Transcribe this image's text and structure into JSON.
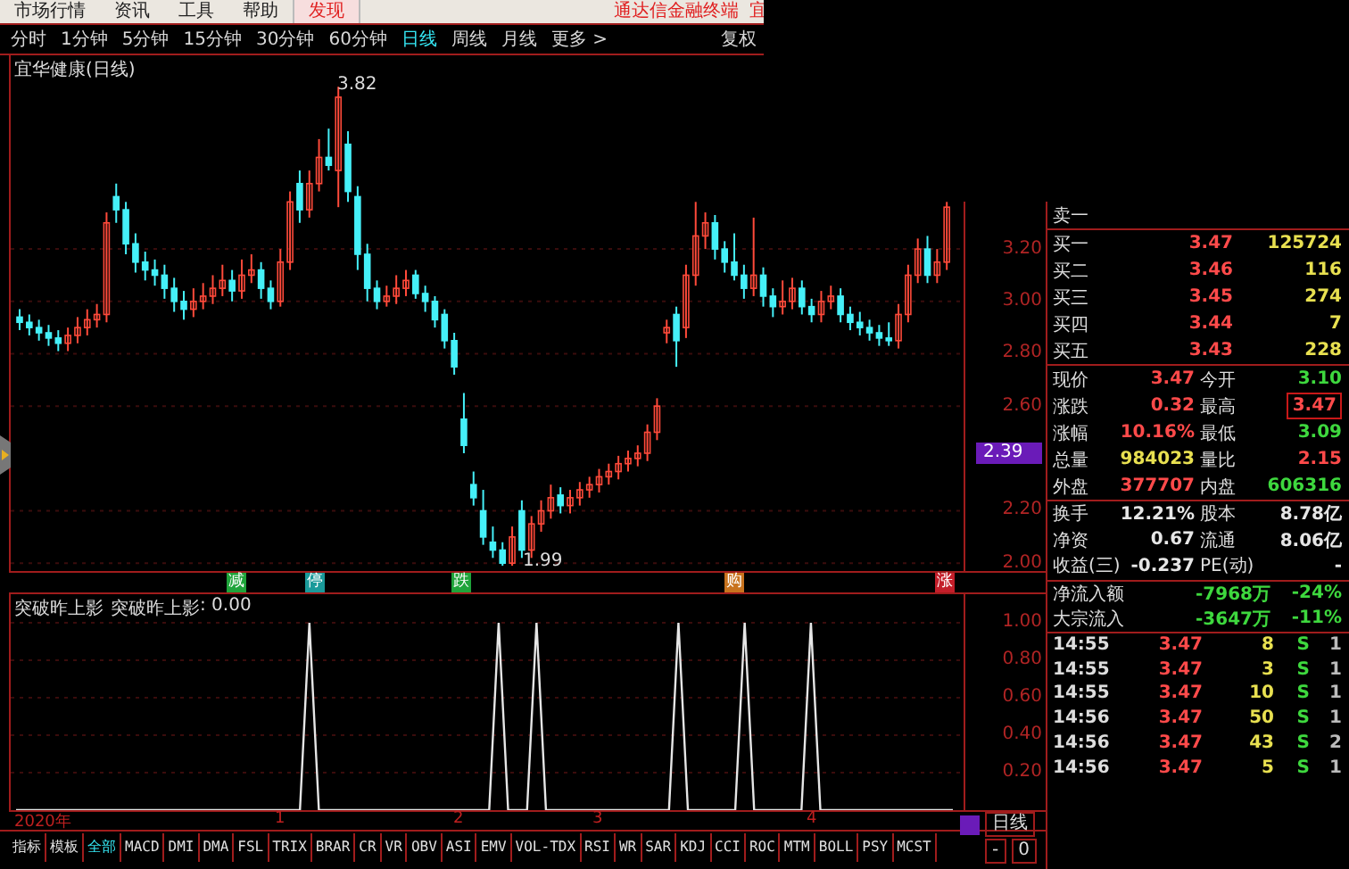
{
  "menu": {
    "items": [
      {
        "label": "市场行情",
        "selected": false
      },
      {
        "label": "资讯",
        "selected": false
      },
      {
        "label": "工具",
        "selected": false
      },
      {
        "label": "帮助",
        "selected": false
      },
      {
        "label": "发现",
        "selected": true
      }
    ],
    "brand": "通达信金融终端",
    "stock": "宜"
  },
  "periods": [
    {
      "label": "分时",
      "selected": false
    },
    {
      "label": "1分钟",
      "selected": false
    },
    {
      "label": "5分钟",
      "selected": false
    },
    {
      "label": "15分钟",
      "selected": false
    },
    {
      "label": "30分钟",
      "selected": false
    },
    {
      "label": "60分钟",
      "selected": false
    },
    {
      "label": "日线",
      "selected": true
    },
    {
      "label": "周线",
      "selected": false
    },
    {
      "label": "月线",
      "selected": false
    },
    {
      "label": "更多 >",
      "selected": false
    }
  ],
  "adjust_button": "复权",
  "chart": {
    "title": "宜华健康(日线)",
    "high_label": "3.82",
    "low_label": "1.99",
    "current_price": "2.39",
    "chart_data": {
      "type": "candlestick",
      "ylim": [
        1.97,
        3.94
      ],
      "grid": true,
      "yticks": [
        {
          "value": 3.2,
          "label": "3.20"
        },
        {
          "value": 3.0,
          "label": "3.00"
        },
        {
          "value": 2.8,
          "label": "2.80"
        },
        {
          "value": 2.6,
          "label": "2.60"
        },
        {
          "value": 2.2,
          "label": "2.20"
        },
        {
          "value": 2.0,
          "label": "2.00"
        }
      ],
      "ohlc": [
        [
          2.94,
          2.97,
          2.89,
          2.92
        ],
        [
          2.92,
          2.95,
          2.87,
          2.9
        ],
        [
          2.9,
          2.93,
          2.85,
          2.88
        ],
        [
          2.88,
          2.91,
          2.83,
          2.86
        ],
        [
          2.86,
          2.89,
          2.81,
          2.84
        ],
        [
          2.84,
          2.9,
          2.81,
          2.87
        ],
        [
          2.87,
          2.94,
          2.84,
          2.9
        ],
        [
          2.9,
          2.97,
          2.87,
          2.93
        ],
        [
          2.93,
          2.99,
          2.9,
          2.95
        ],
        [
          2.95,
          3.34,
          2.92,
          3.3
        ],
        [
          3.4,
          3.45,
          3.3,
          3.35
        ],
        [
          3.35,
          3.38,
          3.18,
          3.22
        ],
        [
          3.22,
          3.26,
          3.11,
          3.15
        ],
        [
          3.15,
          3.19,
          3.08,
          3.12
        ],
        [
          3.12,
          3.16,
          3.06,
          3.1
        ],
        [
          3.1,
          3.14,
          3.01,
          3.05
        ],
        [
          3.05,
          3.09,
          2.96,
          3.0
        ],
        [
          3.0,
          3.04,
          2.93,
          2.97
        ],
        [
          2.97,
          3.05,
          2.94,
          3.0
        ],
        [
          3.0,
          3.07,
          2.97,
          3.02
        ],
        [
          3.02,
          3.1,
          2.99,
          3.05
        ],
        [
          3.05,
          3.14,
          3.02,
          3.08
        ],
        [
          3.08,
          3.12,
          3.0,
          3.04
        ],
        [
          3.04,
          3.16,
          3.01,
          3.1
        ],
        [
          3.1,
          3.18,
          3.07,
          3.12
        ],
        [
          3.12,
          3.15,
          3.01,
          3.05
        ],
        [
          3.05,
          3.08,
          2.97,
          3.0
        ],
        [
          3.0,
          3.2,
          2.98,
          3.15
        ],
        [
          3.15,
          3.42,
          3.12,
          3.38
        ],
        [
          3.45,
          3.5,
          3.3,
          3.35
        ],
        [
          3.35,
          3.5,
          3.32,
          3.45
        ],
        [
          3.45,
          3.62,
          3.42,
          3.55
        ],
        [
          3.55,
          3.66,
          3.5,
          3.52
        ],
        [
          3.5,
          3.82,
          3.36,
          3.78
        ],
        [
          3.6,
          3.65,
          3.38,
          3.42
        ],
        [
          3.4,
          3.44,
          3.12,
          3.18
        ],
        [
          3.18,
          3.22,
          3.0,
          3.05
        ],
        [
          3.05,
          3.08,
          2.97,
          3.0
        ],
        [
          3.0,
          3.06,
          2.98,
          3.02
        ],
        [
          3.02,
          3.1,
          2.99,
          3.05
        ],
        [
          3.05,
          3.12,
          3.02,
          3.08
        ],
        [
          3.1,
          3.12,
          3.01,
          3.03
        ],
        [
          3.03,
          3.06,
          2.96,
          3.0
        ],
        [
          3.0,
          3.02,
          2.9,
          2.93
        ],
        [
          2.95,
          2.97,
          2.82,
          2.85
        ],
        [
          2.85,
          2.88,
          2.72,
          2.75
        ],
        [
          2.55,
          2.65,
          2.42,
          2.45
        ],
        [
          2.3,
          2.35,
          2.22,
          2.25
        ],
        [
          2.2,
          2.28,
          2.07,
          2.1
        ],
        [
          2.08,
          2.14,
          2.02,
          2.05
        ],
        [
          2.05,
          2.08,
          1.99,
          2.0
        ],
        [
          2.0,
          2.14,
          1.99,
          2.1
        ],
        [
          2.2,
          2.24,
          2.02,
          2.05
        ],
        [
          2.05,
          2.18,
          2.02,
          2.15
        ],
        [
          2.15,
          2.24,
          2.12,
          2.2
        ],
        [
          2.2,
          2.3,
          2.17,
          2.25
        ],
        [
          2.26,
          2.29,
          2.19,
          2.22
        ],
        [
          2.22,
          2.28,
          2.19,
          2.25
        ],
        [
          2.25,
          2.31,
          2.22,
          2.28
        ],
        [
          2.28,
          2.33,
          2.25,
          2.3
        ],
        [
          2.3,
          2.36,
          2.27,
          2.33
        ],
        [
          2.33,
          2.38,
          2.3,
          2.35
        ],
        [
          2.35,
          2.41,
          2.32,
          2.38
        ],
        [
          2.38,
          2.43,
          2.35,
          2.4
        ],
        [
          2.4,
          2.45,
          2.37,
          2.42
        ],
        [
          2.42,
          2.53,
          2.39,
          2.5
        ],
        [
          2.5,
          2.63,
          2.47,
          2.6
        ],
        [
          2.88,
          2.93,
          2.84,
          2.9
        ],
        [
          2.95,
          2.98,
          2.75,
          2.85
        ],
        [
          2.9,
          3.14,
          2.86,
          3.1
        ],
        [
          3.1,
          3.38,
          3.06,
          3.25
        ],
        [
          3.25,
          3.34,
          3.2,
          3.3
        ],
        [
          3.3,
          3.33,
          3.16,
          3.2
        ],
        [
          3.2,
          3.23,
          3.11,
          3.15
        ],
        [
          3.15,
          3.26,
          3.08,
          3.1
        ],
        [
          3.1,
          3.14,
          3.01,
          3.05
        ],
        [
          3.05,
          3.32,
          3.02,
          3.1
        ],
        [
          3.1,
          3.13,
          2.98,
          3.02
        ],
        [
          3.02,
          3.05,
          2.94,
          2.98
        ],
        [
          2.98,
          3.08,
          2.95,
          3.0
        ],
        [
          3.0,
          3.09,
          2.97,
          3.05
        ],
        [
          3.05,
          3.08,
          2.95,
          2.98
        ],
        [
          2.98,
          3.01,
          2.92,
          2.95
        ],
        [
          2.95,
          3.04,
          2.92,
          3.0
        ],
        [
          3.0,
          3.06,
          2.97,
          3.02
        ],
        [
          3.02,
          3.05,
          2.92,
          2.95
        ],
        [
          2.95,
          2.98,
          2.89,
          2.92
        ],
        [
          2.92,
          2.96,
          2.87,
          2.9
        ],
        [
          2.9,
          2.93,
          2.85,
          2.88
        ],
        [
          2.88,
          2.91,
          2.83,
          2.86
        ],
        [
          2.86,
          2.92,
          2.83,
          2.85
        ],
        [
          2.85,
          2.99,
          2.82,
          2.95
        ],
        [
          2.95,
          3.14,
          2.92,
          3.1
        ],
        [
          3.1,
          3.24,
          3.07,
          3.2
        ],
        [
          3.2,
          3.25,
          3.07,
          3.1
        ],
        [
          3.1,
          3.2,
          3.07,
          3.15
        ],
        [
          3.15,
          3.38,
          3.12,
          3.36
        ]
      ]
    },
    "signals": [
      {
        "label": "减",
        "color": "#1fa43a"
      },
      {
        "label": "停",
        "color": "#1a9a9a"
      },
      {
        "label": "跌",
        "color": "#1fa43a"
      },
      {
        "label": "购",
        "color": "#c8731e"
      },
      {
        "label": "涨",
        "color": "#c41e2a"
      }
    ]
  },
  "indicator": {
    "reading": ": 0.00",
    "chart_data": {
      "type": "line",
      "title": "突破昨上影",
      "ylim": [
        0,
        1
      ],
      "grid": true,
      "yticks": [
        {
          "value": 1,
          "label": "1.00"
        },
        {
          "value": 0.8,
          "label": "0.80"
        },
        {
          "value": 0.6,
          "label": "0.60"
        },
        {
          "value": 0.4,
          "label": "0.40"
        },
        {
          "value": 0.2,
          "label": "0.20"
        }
      ],
      "series": [
        {
          "name": "突破昨上影",
          "color": "#e6e6e6",
          "values": [
            0,
            0,
            0,
            0,
            0,
            0,
            0,
            0,
            0,
            0,
            0,
            0,
            0,
            0,
            0,
            0,
            0,
            0,
            0,
            0,
            0,
            0,
            0,
            0,
            0,
            0,
            0,
            0,
            0,
            0,
            0,
            1,
            0,
            0,
            0,
            0,
            0,
            0,
            0,
            0,
            0,
            0,
            0,
            0,
            0,
            0,
            0,
            0,
            0,
            0,
            0,
            1,
            0,
            0,
            0,
            1,
            0,
            0,
            0,
            0,
            0,
            0,
            0,
            0,
            0,
            0,
            0,
            0,
            0,
            0,
            1,
            0,
            0,
            0,
            0,
            0,
            0,
            1,
            0,
            0,
            0,
            0,
            0,
            0,
            1,
            0,
            0,
            0,
            0,
            0,
            0,
            0,
            0,
            0,
            0,
            0,
            0,
            0,
            0,
            0
          ]
        }
      ]
    }
  },
  "dates": [
    "2020年",
    "1",
    "2",
    "3",
    "4"
  ],
  "indicator_tabs": [
    {
      "label": "指标",
      "selected": false
    },
    {
      "label": "模板",
      "selected": false
    },
    {
      "label": "全部",
      "selected": true
    },
    {
      "label": "MACD",
      "selected": false
    },
    {
      "label": "DMI",
      "selected": false
    },
    {
      "label": "DMA",
      "selected": false
    },
    {
      "label": "FSL",
      "selected": false
    },
    {
      "label": "TRIX",
      "selected": false
    },
    {
      "label": "BRAR",
      "selected": false
    },
    {
      "label": "CR",
      "selected": false
    },
    {
      "label": "VR",
      "selected": false
    },
    {
      "label": "OBV",
      "selected": false
    },
    {
      "label": "ASI",
      "selected": false
    },
    {
      "label": "EMV",
      "selected": false
    },
    {
      "label": "VOL-TDX",
      "selected": false
    },
    {
      "label": "RSI",
      "selected": false
    },
    {
      "label": "WR",
      "selected": false
    },
    {
      "label": "SAR",
      "selected": false
    },
    {
      "label": "KDJ",
      "selected": false
    },
    {
      "label": "CCI",
      "selected": false
    },
    {
      "label": "ROC",
      "selected": false
    },
    {
      "label": "MTM",
      "selected": false
    },
    {
      "label": "BOLL",
      "selected": false
    },
    {
      "label": "PSY",
      "selected": false
    },
    {
      "label": "MCST",
      "selected": false
    }
  ],
  "period_label": "日线",
  "zoom_buttons": [
    "-",
    "0"
  ],
  "quote": {
    "sell_label": "卖一",
    "bids": [
      {
        "label": "买一",
        "price": "3.47",
        "volume": "125724"
      },
      {
        "label": "买二",
        "price": "3.46",
        "volume": "116"
      },
      {
        "label": "买三",
        "price": "3.45",
        "volume": "274"
      },
      {
        "label": "买四",
        "price": "3.44",
        "volume": "7"
      },
      {
        "label": "买五",
        "price": "3.43",
        "volume": "228"
      }
    ],
    "stats": [
      [
        {
          "label": "现价",
          "value": "3.47",
          "color": "#ff4a4a",
          "boxed": false
        },
        {
          "label": "今开",
          "value": "3.10",
          "color": "#3ed83e",
          "boxed": false
        }
      ],
      [
        {
          "label": "涨跌",
          "value": "0.32",
          "color": "#ff4a4a",
          "boxed": false
        },
        {
          "label": "最高",
          "value": "3.47",
          "color": "#ff4a4a",
          "boxed": true
        }
      ],
      [
        {
          "label": "涨幅",
          "value": "10.16%",
          "color": "#ff4a4a",
          "boxed": false
        },
        {
          "label": "最低",
          "value": "3.09",
          "color": "#3ed83e",
          "boxed": false
        }
      ],
      [
        {
          "label": "总量",
          "value": "984023",
          "color": "#e8e050",
          "boxed": false
        },
        {
          "label": "量比",
          "value": "2.15",
          "color": "#ff4a4a",
          "boxed": false
        }
      ],
      [
        {
          "label": "外盘",
          "value": "377707",
          "color": "#ff4a4a",
          "boxed": false
        },
        {
          "label": "内盘",
          "value": "606316",
          "color": "#3ed83e",
          "boxed": false
        }
      ]
    ],
    "finance": [
      [
        {
          "label": "换手",
          "value": "12.21%"
        },
        {
          "label": "股本",
          "value": "8.78亿"
        }
      ],
      [
        {
          "label": "净资",
          "value": "0.67"
        },
        {
          "label": "流通",
          "value": "8.06亿"
        }
      ],
      [
        {
          "label": "收益(三)",
          "value": "-0.237"
        },
        {
          "label": "PE(动)",
          "value": "-"
        }
      ]
    ],
    "flows": [
      {
        "label": "净流入额",
        "amount": "-7968万",
        "percent": "-24%"
      },
      {
        "label": "大宗流入",
        "amount": "-3647万",
        "percent": "-11%"
      }
    ],
    "ticks": [
      {
        "time": "14:55",
        "price": "3.47",
        "volume": "8",
        "side": "S",
        "count": "1"
      },
      {
        "time": "14:55",
        "price": "3.47",
        "volume": "3",
        "side": "S",
        "count": "1"
      },
      {
        "time": "14:55",
        "price": "3.47",
        "volume": "10",
        "side": "S",
        "count": "1"
      },
      {
        "time": "14:56",
        "price": "3.47",
        "volume": "50",
        "side": "S",
        "count": "1"
      },
      {
        "time": "14:56",
        "price": "3.47",
        "volume": "43",
        "side": "S",
        "count": "2"
      },
      {
        "time": "14:56",
        "price": "3.47",
        "volume": "5",
        "side": "S",
        "count": "1"
      }
    ]
  }
}
